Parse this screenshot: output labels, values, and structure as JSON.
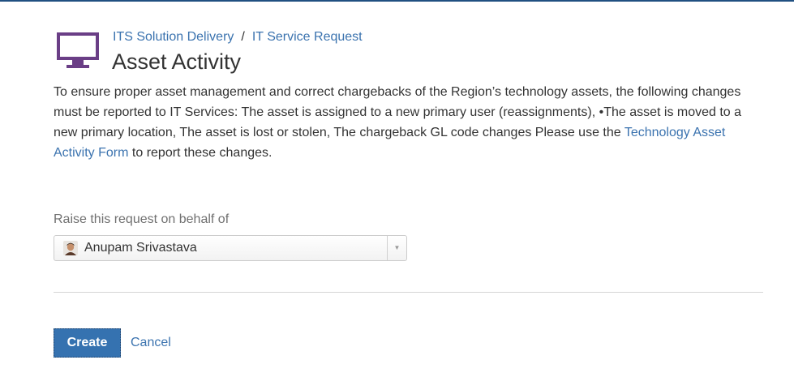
{
  "breadcrumb": {
    "project": "ITS Solution Delivery",
    "separator": "/",
    "request_type": "IT Service Request"
  },
  "page_title": "Asset Activity",
  "description": {
    "text_before_link": "To ensure proper asset management and correct chargebacks of the Region’s technology assets, the following changes must be reported to IT Services: The asset is assigned to a new primary user (reassignments), •The asset is moved to a new primary location, The asset is lost or stolen, The chargeback GL code changes Please use the ",
    "link_text": "Technology Asset Activity Form",
    "text_after_link": " to report these changes."
  },
  "on_behalf": {
    "label": "Raise this request on behalf of",
    "selected_user": "Anupam Srivastava"
  },
  "icons": {
    "header": "monitor-icon",
    "avatar": "user-avatar",
    "dropdown": "chevron-down-icon"
  },
  "colors": {
    "accent": "#3572b0",
    "link": "#3b73af",
    "icon": "#6a3e86",
    "top_rule": "#205081"
  },
  "actions": {
    "create_label": "Create",
    "cancel_label": "Cancel"
  }
}
